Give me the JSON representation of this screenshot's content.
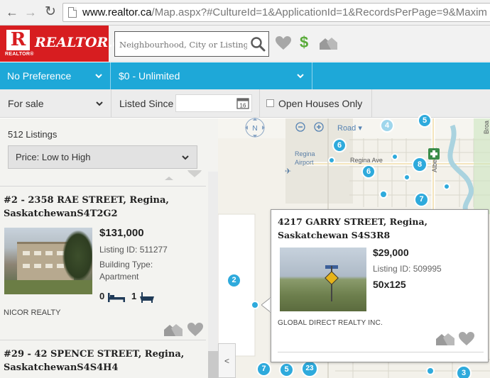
{
  "browser": {
    "url_host": "www.realtor.ca",
    "url_path": "/Map.aspx?#CultureId=1&ApplicationId=1&RecordsPerPage=9&Maxim"
  },
  "header": {
    "brand": "REALTOR.ca",
    "brand_mark_label": "REALTOR®",
    "search_placeholder": "Neighbourhood, City or Listing ...",
    "dollar_symbol": "$"
  },
  "filters": {
    "property_type": "No Preference",
    "price_range": "$0 - Unlimited",
    "transaction_type": "For sale",
    "listed_since_label": "Listed Since",
    "listed_since_value": "",
    "calendar_day": "16",
    "open_houses_label": "Open Houses Only",
    "open_houses_checked": false
  },
  "results": {
    "count_label": "512 Listings",
    "sort_value": "Price: Low to High"
  },
  "listings": [
    {
      "address_line1": "#2 - 2358 RAE STREET, Regina,",
      "address_line2": "SaskatchewanS4T2G2",
      "price": "$131,000",
      "listing_id": "Listing ID: 511277",
      "building_type_line1": "Building Type:",
      "building_type_line2": "Apartment",
      "beds": "0",
      "baths": "1",
      "realty": "NICOR REALTY"
    },
    {
      "address_line1": "#29 - 42 SPENCE STREET, Regina,",
      "address_line2": "SaskatchewanS4S4H4"
    }
  ],
  "map": {
    "compass_label": "N",
    "road_label": "Road ▾",
    "collapse_label": "<",
    "labels": {
      "regina_airport_1": "Regina",
      "regina_airport_2": "Airport",
      "regina_ave": "Regina Ave",
      "albert_st": "Albert St",
      "broad": "Broa"
    },
    "pins": [
      "6",
      "6",
      "8",
      "7",
      "2",
      "5",
      "4",
      "3",
      "7",
      "5",
      "23",
      "3"
    ]
  },
  "popup": {
    "address_line1": "4217 GARRY STREET, Regina,",
    "address_line2": "Saskatchewan S4S3R8",
    "price": "$29,000",
    "listing_id": "Listing ID: 509995",
    "lot_size": "50x125",
    "realty": "GLOBAL DIRECT REALTY INC."
  },
  "colors": {
    "brand_red": "#d71d20",
    "filter_blue": "#1ea8d8",
    "pin_blue": "#2eaadc",
    "dollar_green": "#5aab3a"
  }
}
